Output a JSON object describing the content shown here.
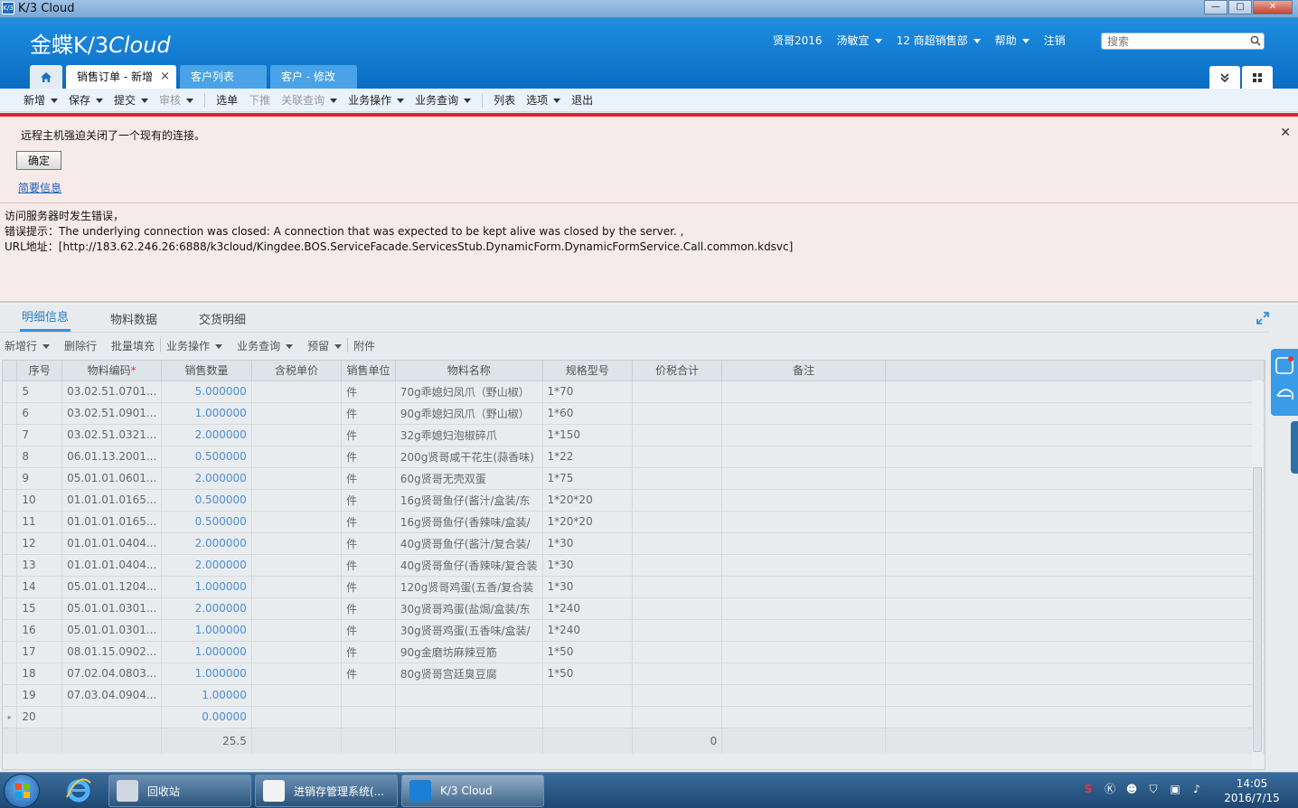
{
  "window": {
    "title": "K/3 Cloud",
    "app_icon_text": "K/3",
    "minimize_glyph": "—",
    "maximize_glyph": "□",
    "close_glyph": "✕"
  },
  "header": {
    "logo_bold": "金蝶K/3",
    "logo_light": "Cloud",
    "nav": [
      {
        "label": "贤哥2016",
        "has_caret": false
      },
      {
        "label": "汤敏宜",
        "has_caret": true
      },
      {
        "label": "12  商超销售部",
        "has_caret": true
      },
      {
        "label": "帮助",
        "has_caret": true
      },
      {
        "label": "注销",
        "has_caret": false
      }
    ],
    "search_placeholder": "搜索"
  },
  "tabs": [
    {
      "label": "销售订单 - 新增",
      "active": true,
      "close": "×"
    },
    {
      "label": "客户列表",
      "active": false
    },
    {
      "label": "客户 - 修改",
      "active": false
    }
  ],
  "toolbar": {
    "items": [
      {
        "label": "新增",
        "caret": true,
        "disabled": false
      },
      {
        "label": "保存",
        "caret": true,
        "disabled": false
      },
      {
        "label": "提交",
        "caret": true,
        "disabled": false
      },
      {
        "label": "审核",
        "caret": true,
        "disabled": true
      },
      {
        "label": "选单",
        "caret": false,
        "disabled": false
      },
      {
        "label": "下推",
        "caret": false,
        "disabled": true
      },
      {
        "label": "关联查询",
        "caret": true,
        "disabled": true
      },
      {
        "label": "业务操作",
        "caret": true,
        "disabled": false
      },
      {
        "label": "业务查询",
        "caret": true,
        "disabled": false
      },
      {
        "label": "列表",
        "caret": false,
        "disabled": false
      },
      {
        "label": "选项",
        "caret": true,
        "disabled": false
      },
      {
        "label": "退出",
        "caret": false,
        "disabled": false
      }
    ]
  },
  "error": {
    "message": "远程主机强迫关闭了一个现有的连接。",
    "ok_label": "确定",
    "summary_link": "简要信息",
    "close_glyph": "✕",
    "detail_lines": [
      "访问服务器时发生错误，",
      "错误提示：The underlying connection was closed: A connection that was expected to be kept alive was closed by the server. ,",
      "URL地址：[http://183.62.246.26:6888/k3cloud/Kingdee.BOS.ServiceFacade.ServicesStub.DynamicForm.DynamicFormService.Call.common.kdsvc]"
    ]
  },
  "detail_tabs": [
    {
      "label": "明细信息",
      "active": true
    },
    {
      "label": "物料数据",
      "active": false
    },
    {
      "label": "交货明细",
      "active": false
    }
  ],
  "entry_toolbar": [
    {
      "label": "新增行",
      "caret": true
    },
    {
      "label": "删除行",
      "caret": false
    },
    {
      "label": "批量填充",
      "caret": false
    },
    {
      "label": "业务操作",
      "caret": true
    },
    {
      "label": "业务查询",
      "caret": true
    },
    {
      "label": "预留",
      "caret": true
    },
    {
      "label": "附件",
      "caret": false
    }
  ],
  "table": {
    "columns": [
      "序号",
      "物料编码",
      "销售数量",
      "含税单价",
      "销售单位",
      "物料名称",
      "规格型号",
      "价税合计",
      "备注"
    ],
    "required_mark": "*",
    "rows": [
      {
        "no": "5",
        "code": "03.02.51.0701...",
        "qty": "5.000000",
        "price": "",
        "unit": "件",
        "name": "70g乖媳妇凤爪（野山椒）",
        "spec": "1*70",
        "total": "",
        "note": ""
      },
      {
        "no": "6",
        "code": "03.02.51.0901...",
        "qty": "1.000000",
        "price": "",
        "unit": "件",
        "name": "90g乖媳妇凤爪（野山椒）",
        "spec": "1*60",
        "total": "",
        "note": ""
      },
      {
        "no": "7",
        "code": "03.02.51.0321...",
        "qty": "2.000000",
        "price": "",
        "unit": "件",
        "name": "32g乖媳妇泡椒碎爪",
        "spec": "1*150",
        "total": "",
        "note": ""
      },
      {
        "no": "8",
        "code": "06.01.13.2001...",
        "qty": "0.500000",
        "price": "",
        "unit": "件",
        "name": "200g贤哥咸干花生(蒜香味)",
        "spec": "1*22",
        "total": "",
        "note": ""
      },
      {
        "no": "9",
        "code": "05.01.01.0601...",
        "qty": "2.000000",
        "price": "",
        "unit": "件",
        "name": "60g贤哥无壳双蛋",
        "spec": "1*75",
        "total": "",
        "note": ""
      },
      {
        "no": "10",
        "code": "01.01.01.0165...",
        "qty": "0.500000",
        "price": "",
        "unit": "件",
        "name": "16g贤哥鱼仔(酱汁/盒装/东",
        "spec": "1*20*20",
        "total": "",
        "note": ""
      },
      {
        "no": "11",
        "code": "01.01.01.0165...",
        "qty": "0.500000",
        "price": "",
        "unit": "件",
        "name": "16g贤哥鱼仔(香辣味/盒装/",
        "spec": "1*20*20",
        "total": "",
        "note": ""
      },
      {
        "no": "12",
        "code": "01.01.01.0404...",
        "qty": "2.000000",
        "price": "",
        "unit": "件",
        "name": "40g贤哥鱼仔(酱汁/复合装/",
        "spec": "1*30",
        "total": "",
        "note": ""
      },
      {
        "no": "13",
        "code": "01.01.01.0404...",
        "qty": "2.000000",
        "price": "",
        "unit": "件",
        "name": "40g贤哥鱼仔(香辣味/复合装",
        "spec": "1*30",
        "total": "",
        "note": ""
      },
      {
        "no": "14",
        "code": "05.01.01.1204...",
        "qty": "1.000000",
        "price": "",
        "unit": "件",
        "name": "120g贤哥鸡蛋(五香/复合装",
        "spec": "1*30",
        "total": "",
        "note": ""
      },
      {
        "no": "15",
        "code": "05.01.01.0301...",
        "qty": "2.000000",
        "price": "",
        "unit": "件",
        "name": "30g贤哥鸡蛋(盐焗/盒装/东",
        "spec": "1*240",
        "total": "",
        "note": ""
      },
      {
        "no": "16",
        "code": "05.01.01.0301...",
        "qty": "1.000000",
        "price": "",
        "unit": "件",
        "name": "30g贤哥鸡蛋(五香味/盒装/",
        "spec": "1*240",
        "total": "",
        "note": ""
      },
      {
        "no": "17",
        "code": "08.01.15.0902...",
        "qty": "1.000000",
        "price": "",
        "unit": "件",
        "name": "90g金磨坊麻辣豆筋",
        "spec": "1*50",
        "total": "",
        "note": ""
      },
      {
        "no": "18",
        "code": "07.02.04.0803...",
        "qty": "1.000000",
        "price": "",
        "unit": "件",
        "name": "80g贤哥宫廷臭豆腐",
        "spec": "1*50",
        "total": "",
        "note": ""
      },
      {
        "no": "19",
        "code": "07.03.04.0904...",
        "qty": "1.00000",
        "price": "",
        "unit": "",
        "name": "",
        "spec": "",
        "total": "",
        "note": ""
      },
      {
        "no": "20",
        "code": "",
        "qty": "0.00000",
        "price": "",
        "unit": "",
        "name": "",
        "spec": "",
        "total": "",
        "note": ""
      }
    ],
    "footer": {
      "qty_total": "25.5",
      "amount_total": "0"
    }
  },
  "taskbar": {
    "buttons": [
      {
        "label": "回收站",
        "active": false
      },
      {
        "label": "进销存管理系统(...",
        "active": false
      },
      {
        "label": "K/3 Cloud",
        "active": true
      }
    ],
    "tray_icons": [
      "sogou-icon",
      "kingdee-icon",
      "qq-icon",
      "shield-icon",
      "network-icon",
      "volume-icon"
    ],
    "time": "14:05",
    "date": "2016/7/15"
  },
  "colors": {
    "header_blue": "#0a6cc4",
    "error_red": "#d9262a",
    "error_bg": "#f7eaea",
    "link_blue": "#1a5fb4",
    "qty_blue": "#4b8ed6"
  }
}
